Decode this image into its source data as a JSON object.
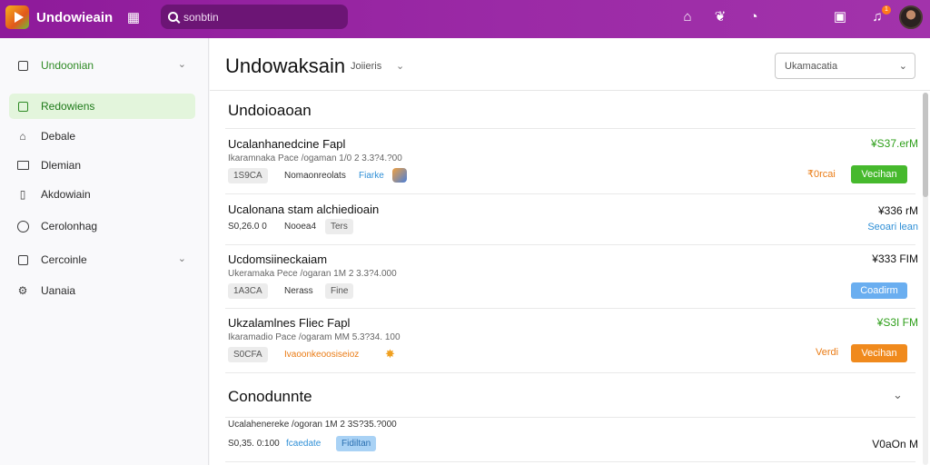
{
  "header": {
    "app_title": "Undowieain",
    "search_placeholder": "sonbtin",
    "notification_count": "1"
  },
  "sidebar": {
    "items": [
      {
        "label": "Undoonian",
        "icon": "box-icon"
      },
      {
        "label": "Redowiens",
        "icon": "box-icon"
      },
      {
        "label": "Debale",
        "icon": "home-icon"
      },
      {
        "label": "Dlemian",
        "icon": "folder-icon"
      },
      {
        "label": "Akdowiain",
        "icon": "mobile-icon"
      },
      {
        "label": "Cerolonhag",
        "icon": "clock-icon"
      },
      {
        "label": "Cercoinle",
        "icon": "box-icon"
      },
      {
        "label": "Uanaia",
        "icon": "settings-icon"
      }
    ]
  },
  "main": {
    "title": "Undowaksain",
    "subtitle": "Joiieris",
    "select_value": "Ukamacatia",
    "section1_title": "Undoioaoan",
    "section2_title": "Conodunnte",
    "rows": [
      {
        "title": "Ucalanhanedcine Fapl",
        "meta": "Ikaramnaka Pace /ogaman 1/0 2 3.3?4.?00",
        "chip": "1S9CA",
        "text": "Nomaonreolats",
        "text2": "Fiarke",
        "price": "¥S37.erM",
        "status": "₹0rcai",
        "button": "Vecihan"
      },
      {
        "title": "Ucalonana stam alchiedioain",
        "meta": "S0,26.0 0",
        "chip_text": "Nooea4",
        "chip": "Ters",
        "price": "¥336 rM",
        "link": "Seoari lean"
      },
      {
        "title": "Ucdomsiineckaiam",
        "meta": "Ukeramaka Pece /ogaran 1M 2 3.3?4.000",
        "chip": "1A3CA",
        "text": "Nerass",
        "chip2": "Fine",
        "price": "¥333 FIM",
        "button": "Coadirm"
      },
      {
        "title": "Ukzalamlnes Fliec Fapl",
        "meta": "Ikaramadio Pace /ogaram MM 5.3?34. 100",
        "chip": "S0CFA",
        "text": "Ivaoonkeoosiseioz",
        "price": "¥S3I FM",
        "status": "Verdi",
        "button": "Vecihan"
      },
      {
        "title": "Ucalahenereke /ogoran 1M 2 3S?35.?000",
        "meta": "",
        "chip_text": "S0,35. 0:100",
        "text": "fcaedate",
        "chip": "Fidiltan",
        "price": "V0aOn M"
      }
    ]
  }
}
